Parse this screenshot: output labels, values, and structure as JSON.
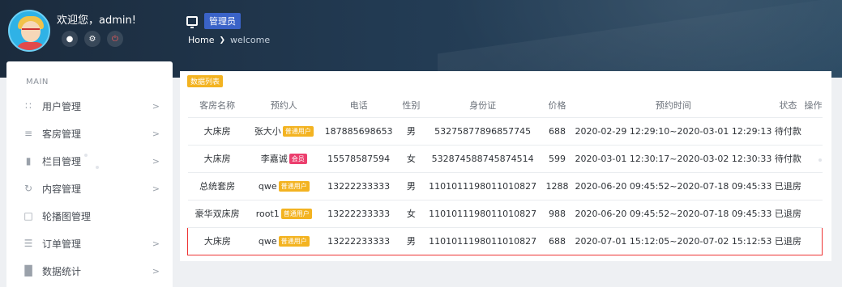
{
  "header": {
    "welcome": "欢迎您，admin!",
    "role": "管理员",
    "breadcrumb": {
      "home": "Home",
      "current": "welcome"
    },
    "user_icons": [
      "user-icon",
      "gear-icon",
      "power-icon"
    ]
  },
  "sidebar": {
    "section_label": "MAIN",
    "items": [
      {
        "label": "用户管理",
        "icon": "grid-icon",
        "chev": true
      },
      {
        "label": "客房管理",
        "icon": "layers-icon",
        "chev": true
      },
      {
        "label": "栏目管理",
        "icon": "file-icon",
        "chev": true
      },
      {
        "label": "内容管理",
        "icon": "refresh-icon",
        "chev": true
      },
      {
        "label": "轮播图管理",
        "icon": "clipboard-icon",
        "chev": false
      },
      {
        "label": "订单管理",
        "icon": "list-icon",
        "chev": true
      },
      {
        "label": "数据统计",
        "icon": "bar-chart-icon",
        "chev": true
      }
    ]
  },
  "main": {
    "tag": "数据列表",
    "columns": [
      "客房名称",
      "预约人",
      "电话",
      "性别",
      "身份证",
      "价格",
      "预约时间",
      "状态",
      "操作"
    ],
    "rows": [
      {
        "room": "大床房",
        "guest": "张大小",
        "badge": "普通用户",
        "badge_type": "normal",
        "phone": "187885698653",
        "gender": "男",
        "id_card": "53275877896857745",
        "price": "688",
        "time": "2020-02-29 12:29:10~2020-03-01 12:29:13",
        "status": "待付款",
        "action": ""
      },
      {
        "room": "大床房",
        "guest": "李嘉诚",
        "badge": "会员",
        "badge_type": "member",
        "phone": "15578587594",
        "gender": "女",
        "id_card": "532874588745874514",
        "price": "599",
        "time": "2020-03-01 12:30:17~2020-03-02 12:30:33",
        "status": "待付款",
        "action": ""
      },
      {
        "room": "总统套房",
        "guest": "qwe",
        "badge": "普通用户",
        "badge_type": "normal",
        "phone": "13222233333",
        "gender": "男",
        "id_card": "1101011198011010827",
        "price": "1288",
        "time": "2020-06-20 09:45:52~2020-07-18 09:45:33",
        "status": "已退房",
        "action": ""
      },
      {
        "room": "豪华双床房",
        "guest": "root1",
        "badge": "普通用户",
        "badge_type": "normal",
        "phone": "13222233333",
        "gender": "女",
        "id_card": "1101011198011010827",
        "price": "988",
        "time": "2020-06-20 09:45:52~2020-07-18 09:45:33",
        "status": "已退房",
        "action": ""
      },
      {
        "room": "大床房",
        "guest": "qwe",
        "badge": "普通用户",
        "badge_type": "normal",
        "phone": "13222233333",
        "gender": "男",
        "id_card": "1101011198011010827",
        "price": "688",
        "time": "2020-07-01 15:12:05~2020-07-02 15:12:53",
        "status": "已退房",
        "action": "",
        "highlight": true
      }
    ]
  },
  "colors": {
    "header_bg": "#1b2b3d",
    "role_badge": "#3a63c8",
    "tag": "#f3b321",
    "badge_member": "#ec3f6e",
    "highlight": "#ee3333"
  }
}
